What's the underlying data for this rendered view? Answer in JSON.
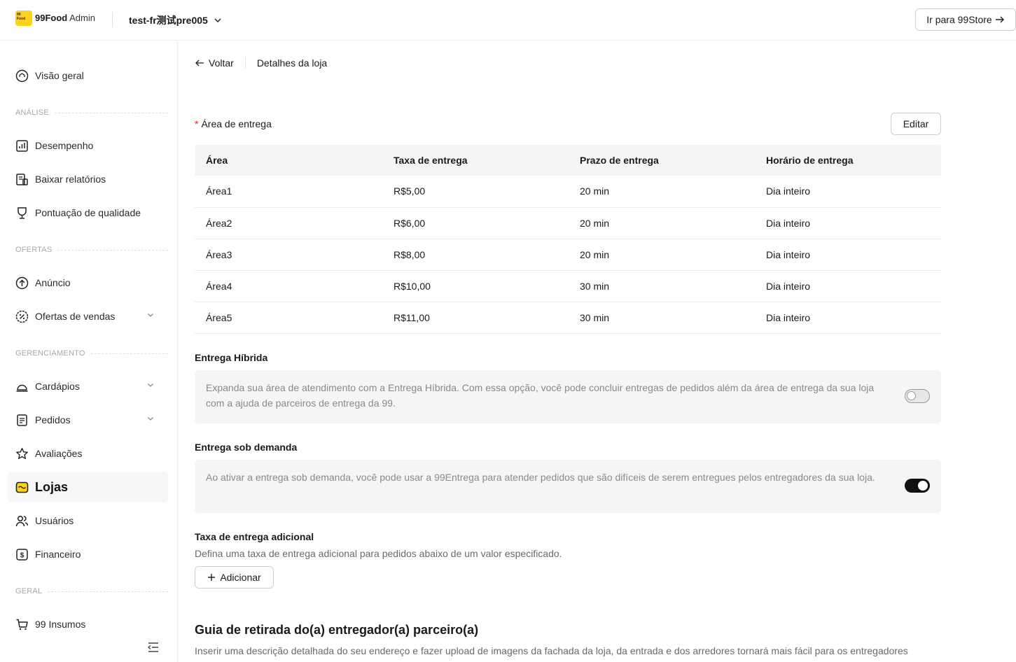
{
  "topbar": {
    "logo_text": "99 Food",
    "brand_bold": "99Food",
    "brand_light": "Admin",
    "store_name": "test-fr测试pre005",
    "goto_label": "Ir para 99Store"
  },
  "sidebar": {
    "overview": "Visão geral",
    "section_analysis": "ANÁLISE",
    "performance": "Desempenho",
    "reports": "Baixar relatórios",
    "quality": "Pontuação de qualidade",
    "section_offers": "OFERTAS",
    "ads": "Anúncio",
    "sales_offers": "Ofertas de vendas",
    "section_management": "GERENCIAMENTO",
    "menus": "Cardápios",
    "orders": "Pedidos",
    "reviews": "Avaliações",
    "stores": "Lojas",
    "users": "Usuários",
    "finance": "Financeiro",
    "section_general": "GERAL",
    "supplies": "99 Insumos"
  },
  "main": {
    "back_label": "Voltar",
    "page_title": "Detalhes da loja",
    "delivery_area": {
      "required_mark": "*",
      "title": "Área de entrega",
      "edit_label": "Editar",
      "columns": [
        "Área",
        "Taxa de entrega",
        "Prazo de entrega",
        "Horário de entrega"
      ],
      "rows": [
        [
          "Área1",
          "R$5,00",
          "20 min",
          "Dia inteiro"
        ],
        [
          "Área2",
          "R$6,00",
          "20 min",
          "Dia inteiro"
        ],
        [
          "Área3",
          "R$8,00",
          "20 min",
          "Dia inteiro"
        ],
        [
          "Área4",
          "R$10,00",
          "30 min",
          "Dia inteiro"
        ],
        [
          "Área5",
          "R$11,00",
          "30 min",
          "Dia inteiro"
        ]
      ]
    },
    "hybrid": {
      "title": "Entrega Híbrida",
      "description": "Expanda sua área de atendimento com a Entrega Híbrida. Com essa opção, você pode concluir entregas de pedidos além da área de entrega da sua loja com a ajuda de parceiros de entrega da 99.",
      "enabled": false
    },
    "on_demand": {
      "title": "Entrega sob demanda",
      "description": "Ao ativar a entrega sob demanda, você pode usar a 99Entrega para atender pedidos que são difíceis de serem entregues pelos entregadores da sua loja.",
      "enabled": true
    },
    "extra_fee": {
      "title": "Taxa de entrega adicional",
      "description": "Defina uma taxa de entrega adicional para pedidos abaixo de um valor especificado.",
      "add_label": "Adicionar"
    },
    "pickup_guide": {
      "title": "Guia de retirada do(a) entregador(a) parceiro(a)",
      "description": "Inserir uma descrição detalhada do seu endereço e fazer upload de imagens da fachada da loja, da entrada e dos arredores tornará mais fácil para os entregadores parceiros encontrarem você."
    }
  }
}
